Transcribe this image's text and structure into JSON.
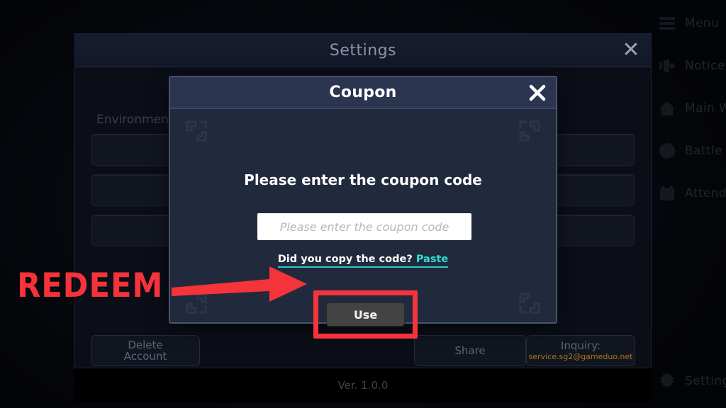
{
  "side_rail": {
    "items": [
      {
        "label": "Menu",
        "icon": "hamburger-menu-icon"
      },
      {
        "label": "Notice",
        "icon": "megaphone-icon"
      },
      {
        "label": "Main W",
        "icon": "house-icon"
      },
      {
        "label": "Battle",
        "icon": "question-circle-icon"
      },
      {
        "label": "Attenda",
        "icon": "calendar-check-icon"
      },
      {
        "label": "Setting",
        "icon": "gear-icon"
      }
    ]
  },
  "settings": {
    "title": "Settings",
    "close_label": "✕",
    "environment_label": "Environment",
    "footer": {
      "delete_account_line1": "Delete",
      "delete_account_line2": "Account",
      "share_label": "Share",
      "inquiry_label": "Inquiry:",
      "inquiry_email": "service.sg2@gameduo.net"
    },
    "version": "Ver. 1.0.0"
  },
  "coupon_modal": {
    "title": "Coupon",
    "close_icon": "close-icon",
    "prompt": "Please enter the coupon code",
    "input_value": "",
    "input_placeholder": "Please enter the coupon code",
    "paste_question": "Did you copy the code?",
    "paste_link": "Paste",
    "use_button_label": "Use"
  },
  "annotation": {
    "redeem_text": "REDEEM",
    "arrow_icon": "right-arrow-icon",
    "highlight_color": "#f5333a"
  },
  "colors": {
    "modal_header": "#2b3550",
    "modal_body": "#212a3d",
    "modal_border": "#49536f",
    "paste_accent": "#2ee0d6",
    "inquiry_email": "#a9761c",
    "annotation_red": "#f5333a",
    "use_button": "#434343"
  }
}
